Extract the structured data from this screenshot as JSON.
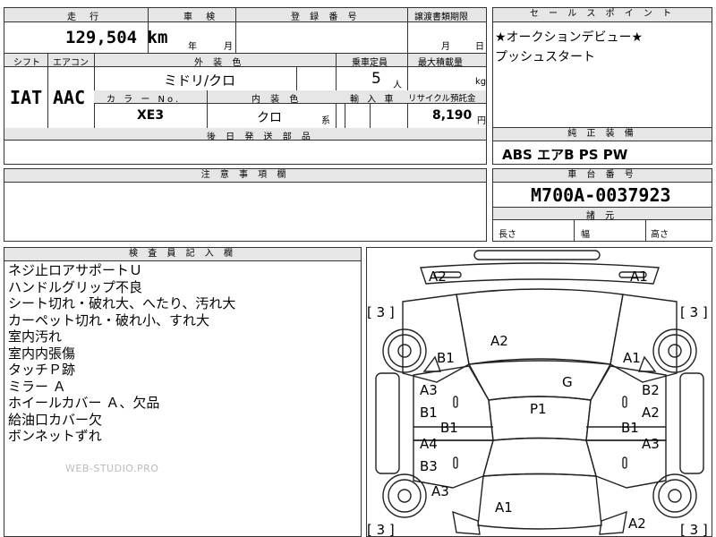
{
  "top": {
    "mileage_label": "走 行",
    "mileage_value": "129,504",
    "mileage_unit": "km",
    "inspection_label": "車 検",
    "inspection_year": "年",
    "inspection_month": "月",
    "registration_label": "登 録 番 号",
    "transfer_label": "譲渡書類期限",
    "transfer_month": "月",
    "transfer_day": "日"
  },
  "row2": {
    "shift_label": "シフト",
    "aircon_label": "エアコン",
    "exterior_label": "外 装 色",
    "capacity_label": "乗車定員",
    "max_load_label": "最大積載量",
    "shift_value": "IAT",
    "aircon_value": "AAC",
    "exterior_value": "ミドリ/クロ",
    "capacity_value": "5",
    "capacity_unit": "人",
    "max_load_unit": "kg",
    "color_no_label": "カ ラ ー No.",
    "interior_label": "内 装 色",
    "import_label": "輸 入 車",
    "recycle_label": "リサイクル預託金",
    "color_no_value": "XE3",
    "interior_value": "クロ",
    "interior_suffix": "系",
    "recycle_value": "8,190",
    "recycle_unit": "円",
    "later_parts_label": "後 日 発 送 部 品"
  },
  "sales": {
    "label": "セ ー ル ス ポ イ ン ト",
    "lines": [
      "★オークションデビュー★",
      "プッシュスタート"
    ]
  },
  "equipment": {
    "label": "純 正 装 備",
    "value": "ABS エアB PS PW"
  },
  "caution": {
    "label": "注 意 事 項 欄"
  },
  "chassis": {
    "label": "車 台 番 号",
    "value": "M700A-0037923",
    "dims_label": "諸 元",
    "length_label": "長さ",
    "width_label": "幅",
    "height_label": "高さ"
  },
  "inspector": {
    "label": "検 査 員 記 入 欄",
    "notes": [
      "ネジ止ロアサポートＵ",
      "ハンドルグリップ不良",
      "シート切れ・破れ大、へたり、汚れ大",
      "カーペット切れ・破れ小、すれ大",
      "室内汚れ",
      "室内内張傷",
      "タッチＰ跡",
      "ミラー Ａ",
      "ホイールカバー Ａ、欠品",
      "給油口カバー欠",
      "ボンネットずれ"
    ],
    "watermark": "WEB-STUDIO.PRO"
  },
  "diagram": {
    "marks": {
      "front_left": "A2",
      "front_right": "A1",
      "tire_fl": "[ 3 ]",
      "tire_fr": "[ 3 ]",
      "tire_rl": "[ 3 ]",
      "tire_rr": "[ 3 ]",
      "hood": "A2",
      "fender_left": "B1",
      "fender_right": "A1",
      "windshield": "G",
      "roof": "P1",
      "door_fl_a": "A3",
      "door_fl_b": "B1",
      "door_fr_a": "B2",
      "door_fr_b": "A2",
      "pillar_left": "B1",
      "pillar_right": "B1",
      "door_rl_a": "A4",
      "door_rl_b": "B3",
      "door_rr_a": "A3",
      "quarter_left": "A3",
      "trunk": "A1",
      "rear_right": "A2"
    }
  }
}
